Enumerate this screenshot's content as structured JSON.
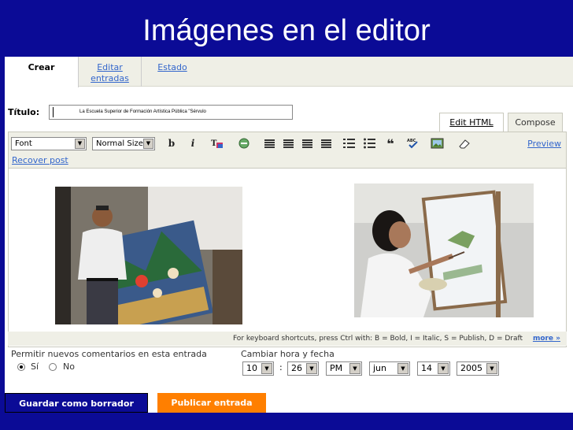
{
  "slide": {
    "title": "Imágenes en el editor"
  },
  "tabs": [
    {
      "label": "Crear"
    },
    {
      "label": "Editar\nentradas"
    },
    {
      "label": "Estado"
    }
  ],
  "post_title": {
    "label": "Título:",
    "value": "La Escuela Superior de Formación Artística Pública \"Sérvulo"
  },
  "mode_tabs": {
    "edit_html": "Edit HTML",
    "compose": "Compose"
  },
  "toolbar": {
    "font": "Font",
    "size": "Normal Size",
    "bold": "b",
    "italic": "i",
    "preview": "Preview",
    "recover": "Recover post"
  },
  "shortcuts": {
    "text": "For keyboard shortcuts, press Ctrl with: B = Bold, I = Italic, S = Publish, D = Draft",
    "more": "more »"
  },
  "comments": {
    "label": "Permitir nuevos comentarios en esta entrada",
    "yes": "Sí",
    "no": "No",
    "selected": "Sí"
  },
  "datetime": {
    "label": "Cambiar hora y fecha",
    "hour": "10",
    "minute": "26",
    "ampm": "PM",
    "month": "jun",
    "day": "14",
    "year": "2005",
    "separator": ":"
  },
  "actions": {
    "draft": "Guardar como borrador",
    "publish": "Publicar entrada"
  },
  "colors": {
    "banner": "#0b0b96",
    "publish": "#ff7f00",
    "link": "#3366cc",
    "toolbar_bg": "#efefe6"
  },
  "icons": [
    "text-color-icon",
    "link-icon",
    "align-left-icon",
    "align-center-icon",
    "align-right-icon",
    "justify-icon",
    "numbered-list-icon",
    "bullet-list-icon",
    "blockquote-icon",
    "spellcheck-icon",
    "image-icon",
    "eraser-icon"
  ]
}
